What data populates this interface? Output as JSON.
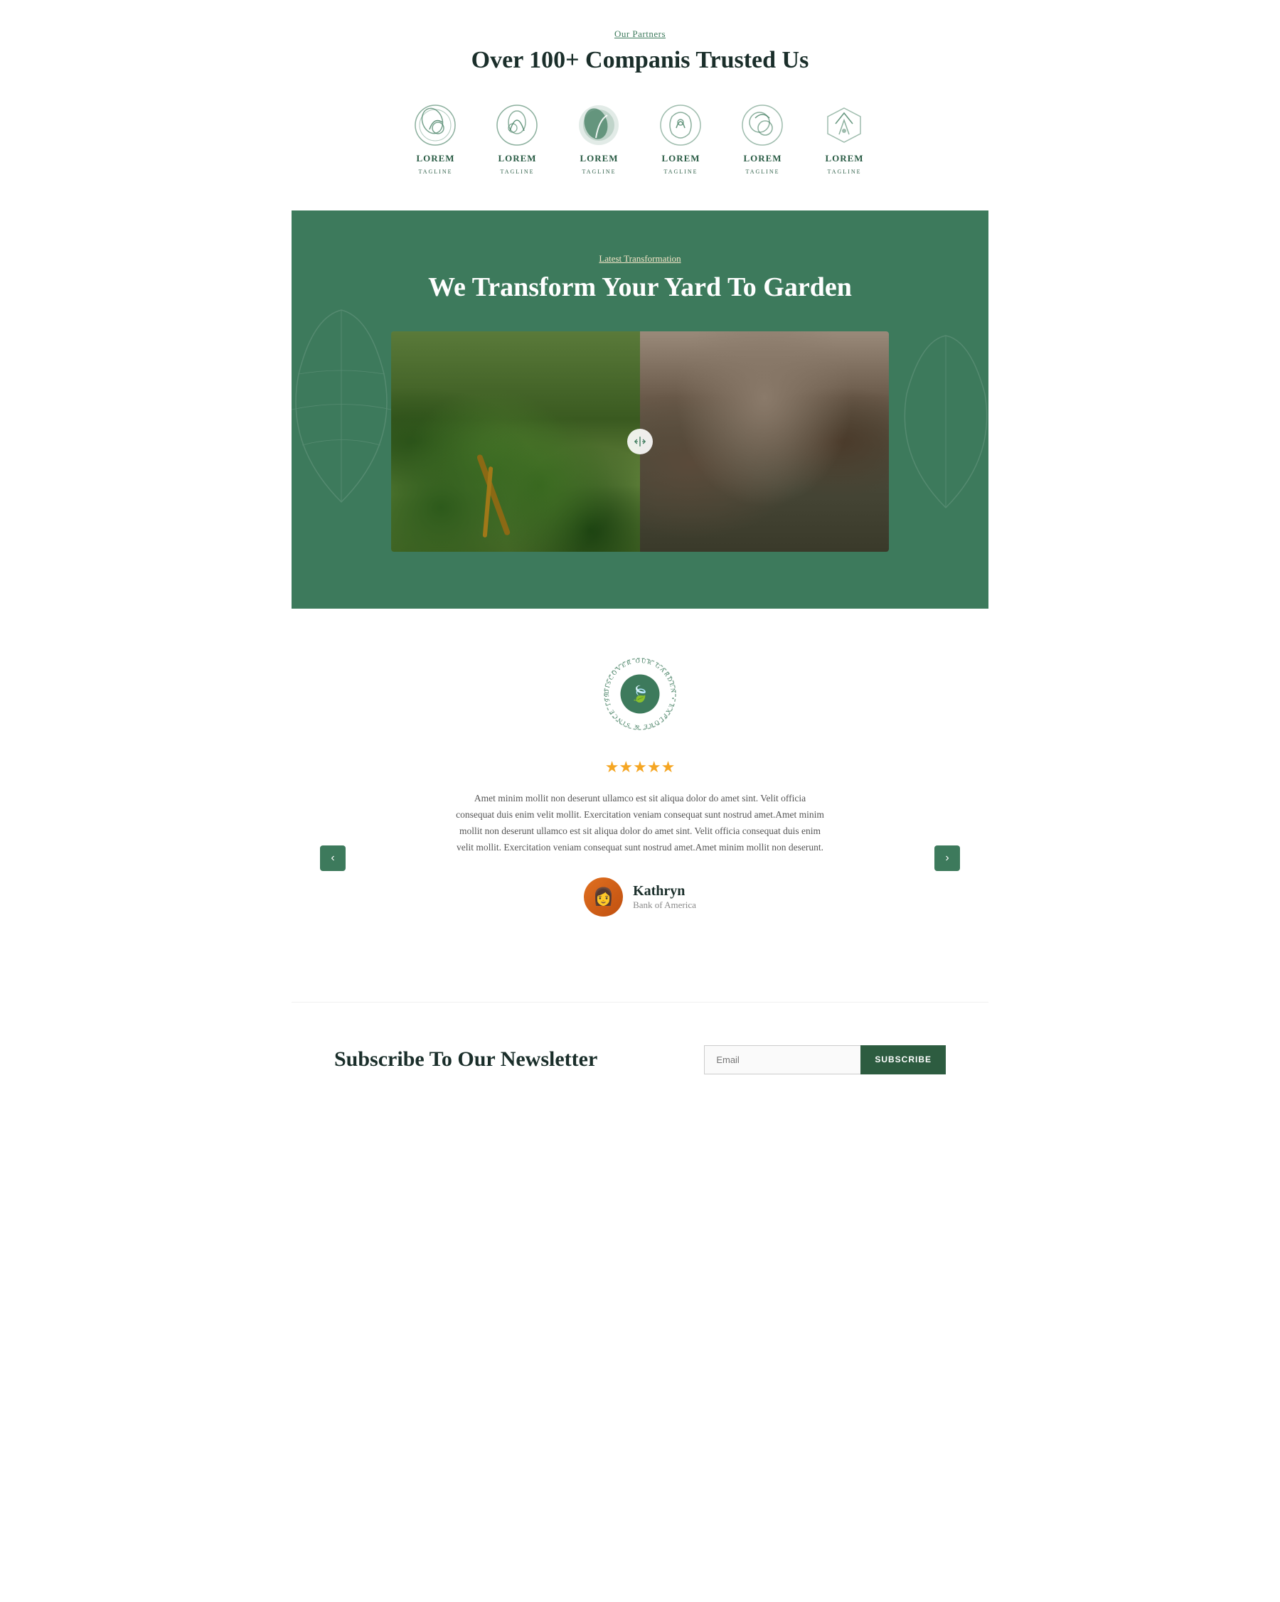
{
  "partners": {
    "label": "Our Partners",
    "title": "Over 100+ Companis Trusted Us",
    "logos": [
      {
        "id": 1,
        "name": "LOREM",
        "tagline": "TAGLINE"
      },
      {
        "id": 2,
        "name": "LOREM",
        "tagline": "TAGLINE"
      },
      {
        "id": 3,
        "name": "LOREM",
        "tagline": "TAGLINE"
      },
      {
        "id": 4,
        "name": "LOREM",
        "tagline": "TAGLINE"
      },
      {
        "id": 5,
        "name": "LOREM",
        "tagline": "TAGLINE"
      },
      {
        "id": 6,
        "name": "LOREM",
        "tagline": "TAGLINE"
      }
    ]
  },
  "transformation": {
    "label": "Latest Transformation",
    "title": "We Transform Your Yard To Garden"
  },
  "discovery": {
    "badge_text": "DISCOVER OUR GARDEN • EXPLORE & SINCE 1997 •"
  },
  "testimonial": {
    "stars": "★★★★★",
    "text": "Amet minim mollit non deserunt ullamco est sit aliqua dolor do amet sint. Velit officia consequat duis enim velit mollit. Exercitation veniam consequat sunt nostrud amet.Amet minim mollit non deserunt ullamco est sit aliqua dolor do amet sint. Velit officia consequat duis enim velit mollit. Exercitation veniam consequat sunt nostrud amet.Amet minim mollit non deserunt.",
    "prev_label": "‹",
    "next_label": "›",
    "author": {
      "name": "Kathryn",
      "company": "Bank of America",
      "avatar_emoji": "👩"
    }
  },
  "newsletter": {
    "title": "Subscribe To Our Newsletter",
    "input_placeholder": "Email",
    "button_label": "SUBSCRIBE"
  },
  "colors": {
    "primary_green": "#3d7a5c",
    "dark_green": "#2d5c40",
    "text_dark": "#1a2e2a",
    "accent_gold": "#f5a623"
  }
}
